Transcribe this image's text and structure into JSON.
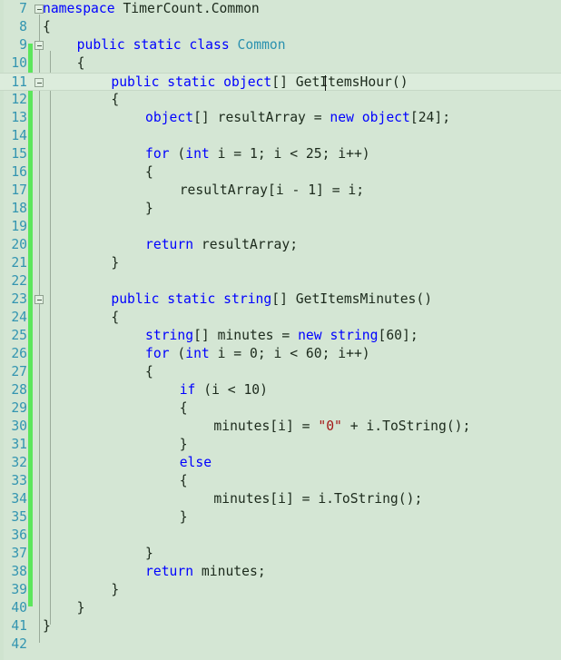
{
  "editor": {
    "name": "visual-studio-code-editor",
    "background_color": "#d4e6d4",
    "current_line_color": "#dcecdc",
    "change_bar_color": "#5ce65c",
    "line_number_color": "#2b91af",
    "keyword_color": "#0000ff",
    "type_color": "#2b91af",
    "string_color": "#a31515",
    "text_color": "#1c2a1c",
    "first_line_number": 7,
    "last_line_number": 42,
    "current_line_number": 11,
    "caret_line": 11,
    "caret_column": 33,
    "language": "C#"
  },
  "lines": [
    {
      "n": "7",
      "fold": true,
      "indent": 0,
      "tokens": [
        {
          "t": "namespace",
          "c": "kw"
        },
        {
          "t": " ",
          "c": "pl"
        },
        {
          "t": "TimerCount.Common",
          "c": "pl"
        }
      ]
    },
    {
      "n": "8",
      "fold": false,
      "indent": 0,
      "tokens": [
        {
          "t": "{",
          "c": "pl"
        }
      ]
    },
    {
      "n": "9",
      "fold": true,
      "indent": 1,
      "tokens": [
        {
          "t": "public",
          "c": "kw"
        },
        {
          "t": " ",
          "c": "pl"
        },
        {
          "t": "static",
          "c": "kw"
        },
        {
          "t": " ",
          "c": "pl"
        },
        {
          "t": "class",
          "c": "kw"
        },
        {
          "t": " ",
          "c": "pl"
        },
        {
          "t": "Common",
          "c": "typ"
        }
      ]
    },
    {
      "n": "10",
      "fold": false,
      "indent": 1,
      "tokens": [
        {
          "t": "{",
          "c": "pl"
        }
      ]
    },
    {
      "n": "11",
      "fold": true,
      "indent": 2,
      "tokens": [
        {
          "t": "public",
          "c": "kw"
        },
        {
          "t": " ",
          "c": "pl"
        },
        {
          "t": "static",
          "c": "kw"
        },
        {
          "t": " ",
          "c": "pl"
        },
        {
          "t": "object",
          "c": "kw"
        },
        {
          "t": "[] ",
          "c": "pl"
        },
        {
          "t": "GetItemsHour()",
          "c": "pl"
        }
      ]
    },
    {
      "n": "12",
      "fold": false,
      "indent": 2,
      "tokens": [
        {
          "t": "{",
          "c": "pl"
        }
      ]
    },
    {
      "n": "13",
      "fold": false,
      "indent": 3,
      "tokens": [
        {
          "t": "object",
          "c": "kw"
        },
        {
          "t": "[] resultArray = ",
          "c": "pl"
        },
        {
          "t": "new",
          "c": "kw"
        },
        {
          "t": " ",
          "c": "pl"
        },
        {
          "t": "object",
          "c": "kw"
        },
        {
          "t": "[",
          "c": "pl"
        },
        {
          "t": "24",
          "c": "num"
        },
        {
          "t": "];",
          "c": "pl"
        }
      ]
    },
    {
      "n": "14",
      "fold": false,
      "indent": 0,
      "tokens": []
    },
    {
      "n": "15",
      "fold": false,
      "indent": 3,
      "tokens": [
        {
          "t": "for",
          "c": "kw"
        },
        {
          "t": " (",
          "c": "pl"
        },
        {
          "t": "int",
          "c": "kw"
        },
        {
          "t": " i = ",
          "c": "pl"
        },
        {
          "t": "1",
          "c": "num"
        },
        {
          "t": "; i < ",
          "c": "pl"
        },
        {
          "t": "25",
          "c": "num"
        },
        {
          "t": "; i++)",
          "c": "pl"
        }
      ]
    },
    {
      "n": "16",
      "fold": false,
      "indent": 3,
      "tokens": [
        {
          "t": "{",
          "c": "pl"
        }
      ]
    },
    {
      "n": "17",
      "fold": false,
      "indent": 4,
      "tokens": [
        {
          "t": "resultArray[i - ",
          "c": "pl"
        },
        {
          "t": "1",
          "c": "num"
        },
        {
          "t": "] = i;",
          "c": "pl"
        }
      ]
    },
    {
      "n": "18",
      "fold": false,
      "indent": 3,
      "tokens": [
        {
          "t": "}",
          "c": "pl"
        }
      ]
    },
    {
      "n": "19",
      "fold": false,
      "indent": 0,
      "tokens": []
    },
    {
      "n": "20",
      "fold": false,
      "indent": 3,
      "tokens": [
        {
          "t": "return",
          "c": "kw"
        },
        {
          "t": " resultArray;",
          "c": "pl"
        }
      ]
    },
    {
      "n": "21",
      "fold": false,
      "indent": 2,
      "tokens": [
        {
          "t": "}",
          "c": "pl"
        }
      ]
    },
    {
      "n": "22",
      "fold": false,
      "indent": 0,
      "tokens": []
    },
    {
      "n": "23",
      "fold": true,
      "indent": 2,
      "tokens": [
        {
          "t": "public",
          "c": "kw"
        },
        {
          "t": " ",
          "c": "pl"
        },
        {
          "t": "static",
          "c": "kw"
        },
        {
          "t": " ",
          "c": "pl"
        },
        {
          "t": "string",
          "c": "kw"
        },
        {
          "t": "[] GetItemsMinutes()",
          "c": "pl"
        }
      ]
    },
    {
      "n": "24",
      "fold": false,
      "indent": 2,
      "tokens": [
        {
          "t": "{",
          "c": "pl"
        }
      ]
    },
    {
      "n": "25",
      "fold": false,
      "indent": 3,
      "tokens": [
        {
          "t": "string",
          "c": "kw"
        },
        {
          "t": "[] minutes = ",
          "c": "pl"
        },
        {
          "t": "new",
          "c": "kw"
        },
        {
          "t": " ",
          "c": "pl"
        },
        {
          "t": "string",
          "c": "kw"
        },
        {
          "t": "[",
          "c": "pl"
        },
        {
          "t": "60",
          "c": "num"
        },
        {
          "t": "];",
          "c": "pl"
        }
      ]
    },
    {
      "n": "26",
      "fold": false,
      "indent": 3,
      "tokens": [
        {
          "t": "for",
          "c": "kw"
        },
        {
          "t": " (",
          "c": "pl"
        },
        {
          "t": "int",
          "c": "kw"
        },
        {
          "t": " i = ",
          "c": "pl"
        },
        {
          "t": "0",
          "c": "num"
        },
        {
          "t": "; i < ",
          "c": "pl"
        },
        {
          "t": "60",
          "c": "num"
        },
        {
          "t": "; i++)",
          "c": "pl"
        }
      ]
    },
    {
      "n": "27",
      "fold": false,
      "indent": 3,
      "tokens": [
        {
          "t": "{",
          "c": "pl"
        }
      ]
    },
    {
      "n": "28",
      "fold": false,
      "indent": 4,
      "tokens": [
        {
          "t": "if",
          "c": "kw"
        },
        {
          "t": " (i < ",
          "c": "pl"
        },
        {
          "t": "10",
          "c": "num"
        },
        {
          "t": ")",
          "c": "pl"
        }
      ]
    },
    {
      "n": "29",
      "fold": false,
      "indent": 4,
      "tokens": [
        {
          "t": "{",
          "c": "pl"
        }
      ]
    },
    {
      "n": "30",
      "fold": false,
      "indent": 5,
      "tokens": [
        {
          "t": "minutes[i] = ",
          "c": "pl"
        },
        {
          "t": "\"0\"",
          "c": "str"
        },
        {
          "t": " + i.ToString();",
          "c": "pl"
        }
      ]
    },
    {
      "n": "31",
      "fold": false,
      "indent": 4,
      "tokens": [
        {
          "t": "}",
          "c": "pl"
        }
      ]
    },
    {
      "n": "32",
      "fold": false,
      "indent": 4,
      "tokens": [
        {
          "t": "else",
          "c": "kw"
        }
      ]
    },
    {
      "n": "33",
      "fold": false,
      "indent": 4,
      "tokens": [
        {
          "t": "{",
          "c": "pl"
        }
      ]
    },
    {
      "n": "34",
      "fold": false,
      "indent": 5,
      "tokens": [
        {
          "t": "minutes[i] = i.ToString();",
          "c": "pl"
        }
      ]
    },
    {
      "n": "35",
      "fold": false,
      "indent": 4,
      "tokens": [
        {
          "t": "}",
          "c": "pl"
        }
      ]
    },
    {
      "n": "36",
      "fold": false,
      "indent": 0,
      "tokens": []
    },
    {
      "n": "37",
      "fold": false,
      "indent": 3,
      "tokens": [
        {
          "t": "}",
          "c": "pl"
        }
      ]
    },
    {
      "n": "38",
      "fold": false,
      "indent": 3,
      "tokens": [
        {
          "t": "return",
          "c": "kw"
        },
        {
          "t": " minutes;",
          "c": "pl"
        }
      ]
    },
    {
      "n": "39",
      "fold": false,
      "indent": 2,
      "tokens": [
        {
          "t": "}",
          "c": "pl"
        }
      ]
    },
    {
      "n": "40",
      "fold": false,
      "indent": 1,
      "tokens": [
        {
          "t": "}",
          "c": "pl"
        }
      ]
    },
    {
      "n": "41",
      "fold": false,
      "indent": 0,
      "tokens": [
        {
          "t": "}",
          "c": "pl"
        }
      ]
    },
    {
      "n": "42",
      "fold": false,
      "indent": 0,
      "tokens": []
    }
  ]
}
